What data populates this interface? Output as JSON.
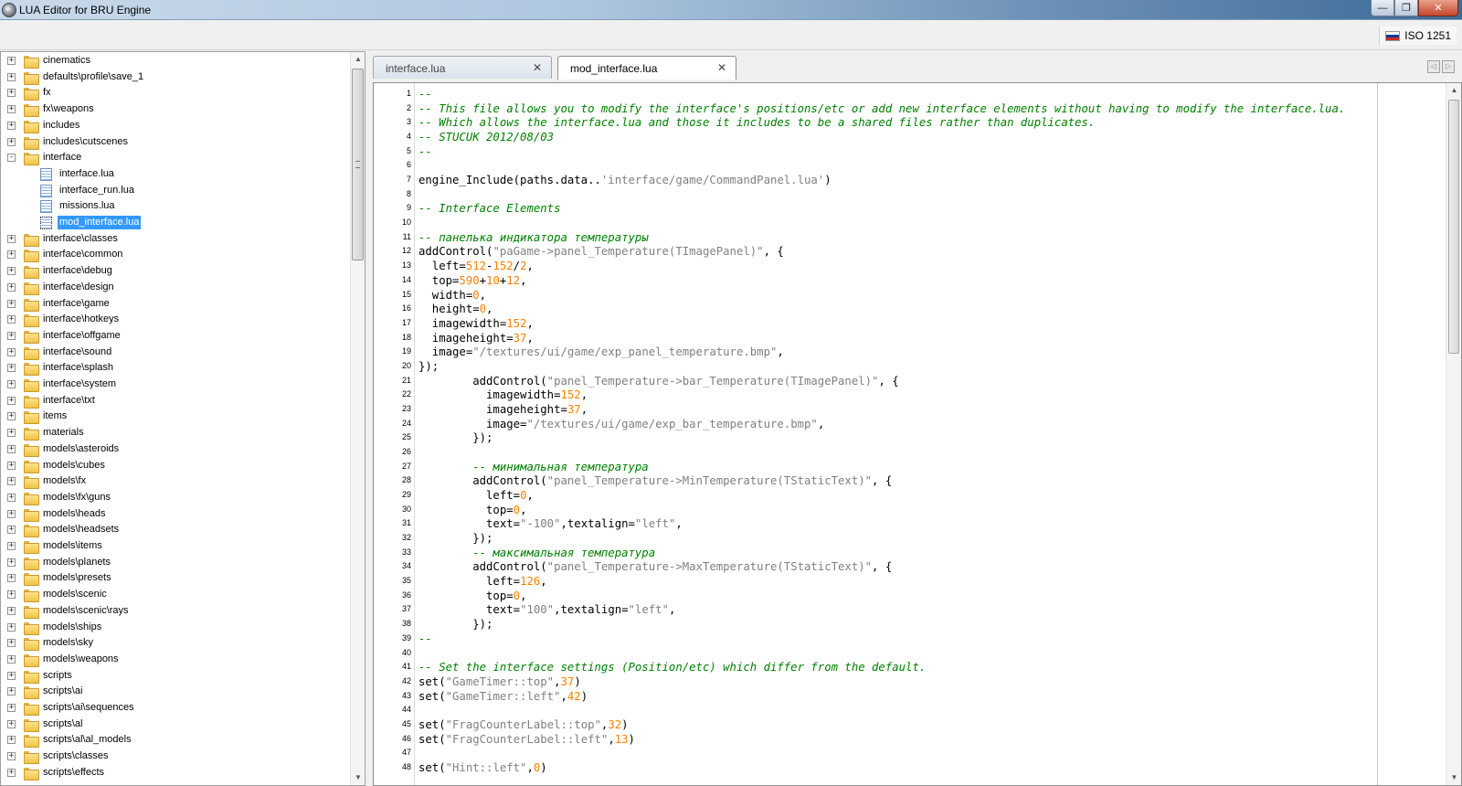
{
  "window": {
    "title": "LUA Editor for BRU Engine",
    "minimize_glyph": "—",
    "maximize_glyph": "❐",
    "close_glyph": "✕"
  },
  "toolbar": {
    "encoding_label": "ISO 1251",
    "flag_colors": [
      "#ffffff",
      "#0039a6",
      "#d52b1e"
    ]
  },
  "tree": {
    "items": [
      {
        "label": "cinematics",
        "type": "folder",
        "state": "+"
      },
      {
        "label": "defaults\\profile\\save_1",
        "type": "folder",
        "state": "+"
      },
      {
        "label": "fx",
        "type": "folder",
        "state": "+"
      },
      {
        "label": "fx\\weapons",
        "type": "folder",
        "state": "+"
      },
      {
        "label": "includes",
        "type": "folder",
        "state": "+"
      },
      {
        "label": "includes\\cutscenes",
        "type": "folder",
        "state": "+"
      },
      {
        "label": "interface",
        "type": "folder",
        "state": "-"
      },
      {
        "label": "interface.lua",
        "type": "file"
      },
      {
        "label": "interface_run.lua",
        "type": "file"
      },
      {
        "label": "missions.lua",
        "type": "file"
      },
      {
        "label": "mod_interface.lua",
        "type": "file",
        "selected": true
      },
      {
        "label": "interface\\classes",
        "type": "folder",
        "state": "+"
      },
      {
        "label": "interface\\common",
        "type": "folder",
        "state": "+"
      },
      {
        "label": "interface\\debug",
        "type": "folder",
        "state": "+"
      },
      {
        "label": "interface\\design",
        "type": "folder",
        "state": "+"
      },
      {
        "label": "interface\\game",
        "type": "folder",
        "state": "+"
      },
      {
        "label": "interface\\hotkeys",
        "type": "folder",
        "state": "+"
      },
      {
        "label": "interface\\offgame",
        "type": "folder",
        "state": "+"
      },
      {
        "label": "interface\\sound",
        "type": "folder",
        "state": "+"
      },
      {
        "label": "interface\\splash",
        "type": "folder",
        "state": "+"
      },
      {
        "label": "interface\\system",
        "type": "folder",
        "state": "+"
      },
      {
        "label": "interface\\txt",
        "type": "folder",
        "state": "+"
      },
      {
        "label": "items",
        "type": "folder",
        "state": "+"
      },
      {
        "label": "materials",
        "type": "folder",
        "state": "+"
      },
      {
        "label": "models\\asteroids",
        "type": "folder",
        "state": "+"
      },
      {
        "label": "models\\cubes",
        "type": "folder",
        "state": "+"
      },
      {
        "label": "models\\fx",
        "type": "folder",
        "state": "+"
      },
      {
        "label": "models\\fx\\guns",
        "type": "folder",
        "state": "+"
      },
      {
        "label": "models\\heads",
        "type": "folder",
        "state": "+"
      },
      {
        "label": "models\\headsets",
        "type": "folder",
        "state": "+"
      },
      {
        "label": "models\\items",
        "type": "folder",
        "state": "+"
      },
      {
        "label": "models\\planets",
        "type": "folder",
        "state": "+"
      },
      {
        "label": "models\\presets",
        "type": "folder",
        "state": "+"
      },
      {
        "label": "models\\scenic",
        "type": "folder",
        "state": "+"
      },
      {
        "label": "models\\scenic\\rays",
        "type": "folder",
        "state": "+"
      },
      {
        "label": "models\\ships",
        "type": "folder",
        "state": "+"
      },
      {
        "label": "models\\sky",
        "type": "folder",
        "state": "+"
      },
      {
        "label": "models\\weapons",
        "type": "folder",
        "state": "+"
      },
      {
        "label": "scripts",
        "type": "folder",
        "state": "+"
      },
      {
        "label": "scripts\\ai",
        "type": "folder",
        "state": "+"
      },
      {
        "label": "scripts\\ai\\sequences",
        "type": "folder",
        "state": "+"
      },
      {
        "label": "scripts\\al",
        "type": "folder",
        "state": "+"
      },
      {
        "label": "scripts\\al\\al_models",
        "type": "folder",
        "state": "+"
      },
      {
        "label": "scripts\\classes",
        "type": "folder",
        "state": "+"
      },
      {
        "label": "scripts\\effects",
        "type": "folder",
        "state": "+"
      }
    ]
  },
  "tabs": [
    {
      "label": "interface.lua",
      "close": "✕",
      "active": false
    },
    {
      "label": "mod_interface.lua",
      "close": "✕",
      "active": true
    }
  ],
  "tab_nav": {
    "prev": "◁",
    "next": "▷"
  },
  "editor": {
    "lines": [
      {
        "n": "1",
        "t": [
          [
            "c",
            "--"
          ]
        ]
      },
      {
        "n": "2",
        "t": [
          [
            "c",
            "-- This file allows you to modify the interface's positions/etc or add new interface elements without having to modify the interface.lua."
          ]
        ]
      },
      {
        "n": "3",
        "t": [
          [
            "c",
            "-- Which allows the interface.lua and those it includes to be a shared files rather than duplicates."
          ]
        ]
      },
      {
        "n": "4",
        "t": [
          [
            "c",
            "-- STUCUK 2012/08/03"
          ]
        ]
      },
      {
        "n": "5",
        "t": [
          [
            "c",
            "--"
          ]
        ]
      },
      {
        "n": "6",
        "t": []
      },
      {
        "n": "7",
        "t": [
          [
            "k",
            "engine_Include(paths.data.."
          ],
          [
            "s",
            "'interface/game/CommandPanel.lua'"
          ],
          [
            "k",
            ")"
          ]
        ]
      },
      {
        "n": "8",
        "t": []
      },
      {
        "n": "9",
        "t": [
          [
            "c",
            "-- Interface Elements"
          ]
        ]
      },
      {
        "n": "10",
        "t": []
      },
      {
        "n": "11",
        "t": [
          [
            "c",
            "-- панелька индикатора температуры"
          ]
        ]
      },
      {
        "n": "12",
        "t": [
          [
            "k",
            "addControl("
          ],
          [
            "s",
            "\"paGame->panel_Temperature(TImagePanel)\""
          ],
          [
            "k",
            ", {"
          ]
        ]
      },
      {
        "n": "13",
        "t": [
          [
            "k",
            "  left="
          ],
          [
            "n",
            "512"
          ],
          [
            "k",
            "-"
          ],
          [
            "n",
            "152"
          ],
          [
            "k",
            "/"
          ],
          [
            "n",
            "2"
          ],
          [
            "k",
            ","
          ]
        ]
      },
      {
        "n": "14",
        "t": [
          [
            "k",
            "  top="
          ],
          [
            "n",
            "590"
          ],
          [
            "k",
            "+"
          ],
          [
            "n",
            "10"
          ],
          [
            "k",
            "+"
          ],
          [
            "n",
            "12"
          ],
          [
            "k",
            ","
          ]
        ]
      },
      {
        "n": "15",
        "t": [
          [
            "k",
            "  width="
          ],
          [
            "n",
            "0"
          ],
          [
            "k",
            ","
          ]
        ]
      },
      {
        "n": "16",
        "t": [
          [
            "k",
            "  height="
          ],
          [
            "n",
            "0"
          ],
          [
            "k",
            ","
          ]
        ]
      },
      {
        "n": "17",
        "t": [
          [
            "k",
            "  imagewidth="
          ],
          [
            "n",
            "152"
          ],
          [
            "k",
            ","
          ]
        ]
      },
      {
        "n": "18",
        "t": [
          [
            "k",
            "  imageheight="
          ],
          [
            "n",
            "37"
          ],
          [
            "k",
            ","
          ]
        ]
      },
      {
        "n": "19",
        "t": [
          [
            "k",
            "  image="
          ],
          [
            "s",
            "\"/textures/ui/game/exp_panel_temperature.bmp\""
          ],
          [
            "k",
            ","
          ]
        ]
      },
      {
        "n": "20",
        "t": [
          [
            "k",
            "});"
          ]
        ]
      },
      {
        "n": "21",
        "t": [
          [
            "k",
            "        addControl("
          ],
          [
            "s",
            "\"panel_Temperature->bar_Temperature(TImagePanel)\""
          ],
          [
            "k",
            ", {"
          ]
        ]
      },
      {
        "n": "22",
        "t": [
          [
            "k",
            "          imagewidth="
          ],
          [
            "n",
            "152"
          ],
          [
            "k",
            ","
          ]
        ]
      },
      {
        "n": "23",
        "t": [
          [
            "k",
            "          imageheight="
          ],
          [
            "n",
            "37"
          ],
          [
            "k",
            ","
          ]
        ]
      },
      {
        "n": "24",
        "t": [
          [
            "k",
            "          image="
          ],
          [
            "s",
            "\"/textures/ui/game/exp_bar_temperature.bmp\""
          ],
          [
            "k",
            ","
          ]
        ]
      },
      {
        "n": "25",
        "t": [
          [
            "k",
            "        });"
          ]
        ]
      },
      {
        "n": "26",
        "t": []
      },
      {
        "n": "27",
        "t": [
          [
            "c",
            "        -- минимальная температура"
          ]
        ]
      },
      {
        "n": "28",
        "t": [
          [
            "k",
            "        addControl("
          ],
          [
            "s",
            "\"panel_Temperature->MinTemperature(TStaticText)\""
          ],
          [
            "k",
            ", {"
          ]
        ]
      },
      {
        "n": "29",
        "t": [
          [
            "k",
            "          left="
          ],
          [
            "n",
            "0"
          ],
          [
            "k",
            ","
          ]
        ]
      },
      {
        "n": "30",
        "t": [
          [
            "k",
            "          top="
          ],
          [
            "n",
            "0"
          ],
          [
            "k",
            ","
          ]
        ]
      },
      {
        "n": "31",
        "t": [
          [
            "k",
            "          text="
          ],
          [
            "s",
            "\"-100\""
          ],
          [
            "k",
            ",textalign="
          ],
          [
            "s",
            "\"left\""
          ],
          [
            "k",
            ","
          ]
        ]
      },
      {
        "n": "32",
        "t": [
          [
            "k",
            "        });"
          ]
        ]
      },
      {
        "n": "33",
        "t": [
          [
            "c",
            "        -- максимальная температура"
          ]
        ]
      },
      {
        "n": "34",
        "t": [
          [
            "k",
            "        addControl("
          ],
          [
            "s",
            "\"panel_Temperature->MaxTemperature(TStaticText)\""
          ],
          [
            "k",
            ", {"
          ]
        ]
      },
      {
        "n": "35",
        "t": [
          [
            "k",
            "          left="
          ],
          [
            "n",
            "126"
          ],
          [
            "k",
            ","
          ]
        ]
      },
      {
        "n": "36",
        "t": [
          [
            "k",
            "          top="
          ],
          [
            "n",
            "0"
          ],
          [
            "k",
            ","
          ]
        ]
      },
      {
        "n": "37",
        "t": [
          [
            "k",
            "          text="
          ],
          [
            "s",
            "\"100\""
          ],
          [
            "k",
            ",textalign="
          ],
          [
            "s",
            "\"left\""
          ],
          [
            "k",
            ","
          ]
        ]
      },
      {
        "n": "38",
        "t": [
          [
            "k",
            "        });"
          ]
        ]
      },
      {
        "n": "39",
        "t": [
          [
            "c",
            "--"
          ]
        ]
      },
      {
        "n": "40",
        "t": []
      },
      {
        "n": "41",
        "t": [
          [
            "c",
            "-- Set the interface settings (Position/etc) which differ from the default."
          ]
        ]
      },
      {
        "n": "42",
        "t": [
          [
            "k",
            "set("
          ],
          [
            "s",
            "\"GameTimer::top\""
          ],
          [
            "k",
            ","
          ],
          [
            "n",
            "37"
          ],
          [
            "k",
            ")"
          ]
        ]
      },
      {
        "n": "43",
        "t": [
          [
            "k",
            "set("
          ],
          [
            "s",
            "\"GameTimer::left\""
          ],
          [
            "k",
            ","
          ],
          [
            "n",
            "42"
          ],
          [
            "k",
            ")"
          ]
        ]
      },
      {
        "n": "44",
        "t": []
      },
      {
        "n": "45",
        "t": [
          [
            "k",
            "set("
          ],
          [
            "s",
            "\"FragCounterLabel::top\""
          ],
          [
            "k",
            ","
          ],
          [
            "n",
            "32"
          ],
          [
            "k",
            ")"
          ]
        ]
      },
      {
        "n": "46",
        "t": [
          [
            "k",
            "set("
          ],
          [
            "s",
            "\"FragCounterLabel::left\""
          ],
          [
            "k",
            ","
          ],
          [
            "n",
            "13"
          ],
          [
            "k",
            ")"
          ]
        ]
      },
      {
        "n": "47",
        "t": []
      },
      {
        "n": "48",
        "t": [
          [
            "k",
            "set("
          ],
          [
            "s",
            "\"Hint::left\""
          ],
          [
            "k",
            ","
          ],
          [
            "n",
            "0"
          ],
          [
            "k",
            ")"
          ]
        ]
      }
    ]
  },
  "scroll_arrows": {
    "up": "▲",
    "down": "▼"
  }
}
